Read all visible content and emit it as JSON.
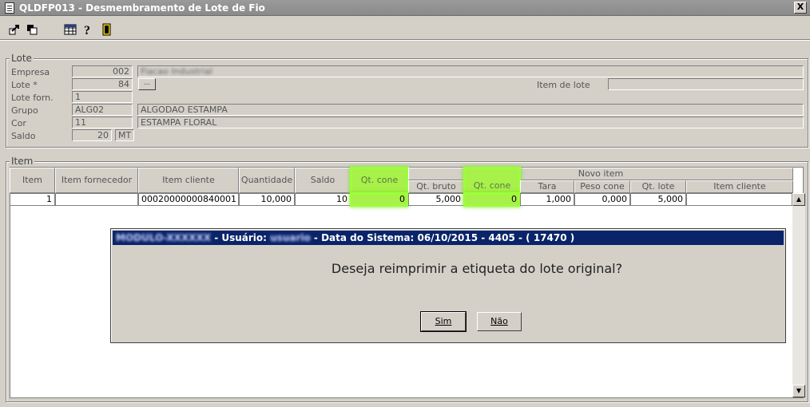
{
  "window": {
    "title": "QLDFP013 - Desmembramento de Lote de Fio",
    "close_label": "X"
  },
  "lote": {
    "legend": "Lote",
    "labels": {
      "empresa": "Empresa",
      "lote": "Lote *",
      "lote_forn": "Lote forn.",
      "grupo": "Grupo",
      "cor": "Cor",
      "saldo": "Saldo",
      "item_de_lote": "Item de lote"
    },
    "values": {
      "empresa_code": "002",
      "empresa_name": "Fiacao Industrial",
      "lote": "84",
      "lote_forn": "1",
      "grupo_code": "ALG02",
      "grupo_name": "ALGODAO ESTAMPA",
      "cor_code": "11",
      "cor_name": "ESTAMPA FLORAL",
      "saldo": "20",
      "saldo_unit": "MT",
      "item_de_lote": ""
    },
    "lookup_button": "..."
  },
  "item": {
    "legend": "Item",
    "group_header": "Novo item",
    "columns": {
      "item": "Item",
      "item_fornecedor": "Item fornecedor",
      "item_cliente": "Item cliente",
      "quantidade": "Quantidade",
      "saldo": "Saldo",
      "qt_cone": "Qt. cone",
      "qt_bruto": "Qt. bruto",
      "novo_qt_cone": "Qt. cone",
      "tara": "Tara",
      "peso_cone": "Peso cone",
      "qt_lote": "Qt. lote",
      "novo_item_cliente": "Item cliente"
    },
    "row": {
      "item": "1",
      "item_fornecedor": "",
      "item_cliente": "00020000000840001",
      "quantidade": "10,000",
      "saldo": "10",
      "qt_cone": "0",
      "qt_bruto": "5,000",
      "novo_qt_cone": "0",
      "tara": "1,000",
      "peso_cone": "0,000",
      "qt_lote": "5,000",
      "novo_item_cliente": ""
    }
  },
  "dialog": {
    "title_blurred": "MODULO-XXXXXX",
    "title_user_label": " - Usuário:",
    "title_user_blurred": "usuario",
    "title_rest": " - Data do Sistema: 06/10/2015 - 4405 - ( 17470 )",
    "message": "Deseja reimprimir a etiqueta do lote original?",
    "yes": "Sim",
    "no": "Não"
  }
}
